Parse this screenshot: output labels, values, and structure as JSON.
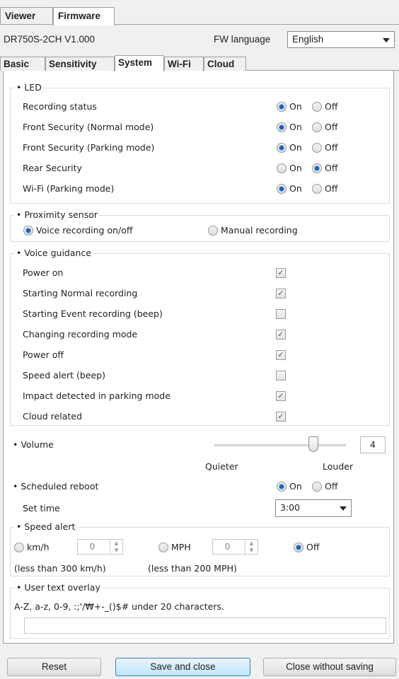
{
  "top_tabs": [
    "Viewer",
    "Firmware"
  ],
  "model_version": "DR750S-2CH   V1.000",
  "fw_language": {
    "label": "FW language",
    "value": "English"
  },
  "sub_tabs": [
    "Basic",
    "Sensitivity",
    "System",
    "Wi-Fi",
    "Cloud"
  ],
  "led": {
    "title": "• LED",
    "rows": [
      {
        "label": "Recording status",
        "state": "on"
      },
      {
        "label": "Front Security (Normal mode)",
        "state": "on"
      },
      {
        "label": "Front Security (Parking mode)",
        "state": "on"
      },
      {
        "label": "Rear Security",
        "state": "off"
      },
      {
        "label": "Wi-Fi (Parking mode)",
        "state": "on"
      }
    ],
    "on_label": "On",
    "off_label": "Off"
  },
  "proximity": {
    "title": "• Proximity sensor",
    "options": [
      "Voice recording on/off",
      "Manual recording"
    ],
    "selected": 0
  },
  "voice": {
    "title": "• Voice guidance",
    "items": [
      {
        "label": "Power on",
        "checked": true
      },
      {
        "label": "Starting Normal recording",
        "checked": true
      },
      {
        "label": "Starting Event recording (beep)",
        "checked": false
      },
      {
        "label": "Changing recording mode",
        "checked": true
      },
      {
        "label": "Power off",
        "checked": true
      },
      {
        "label": "Speed alert (beep)",
        "checked": false
      },
      {
        "label": "Impact detected in parking mode",
        "checked": true
      },
      {
        "label": "Cloud related",
        "checked": true
      }
    ]
  },
  "volume": {
    "title": "• Volume",
    "value": "4",
    "level_fraction": 0.75,
    "min_label": "Quieter",
    "max_label": "Louder"
  },
  "reboot": {
    "title": "• Scheduled reboot",
    "on_label": "On",
    "off_label": "Off",
    "state": "on",
    "set_time_label": "Set time",
    "time": "3:00"
  },
  "speed": {
    "title": "• Speed alert",
    "kmh_label": "km/h",
    "kmh_value": "0",
    "kmh_note": "(less than 300 km/h)",
    "mph_label": "MPH",
    "mph_value": "0",
    "mph_note": "(less than 200 MPH)",
    "off_label": "Off",
    "selected": "off"
  },
  "overlay": {
    "title": "• User text overlay",
    "hint": "A-Z, a-z, 0-9, :;'/₩+-_()$# under 20 characters.",
    "value": ""
  },
  "buttons": {
    "reset": "Reset",
    "save": "Save and close",
    "close": "Close without saving"
  }
}
